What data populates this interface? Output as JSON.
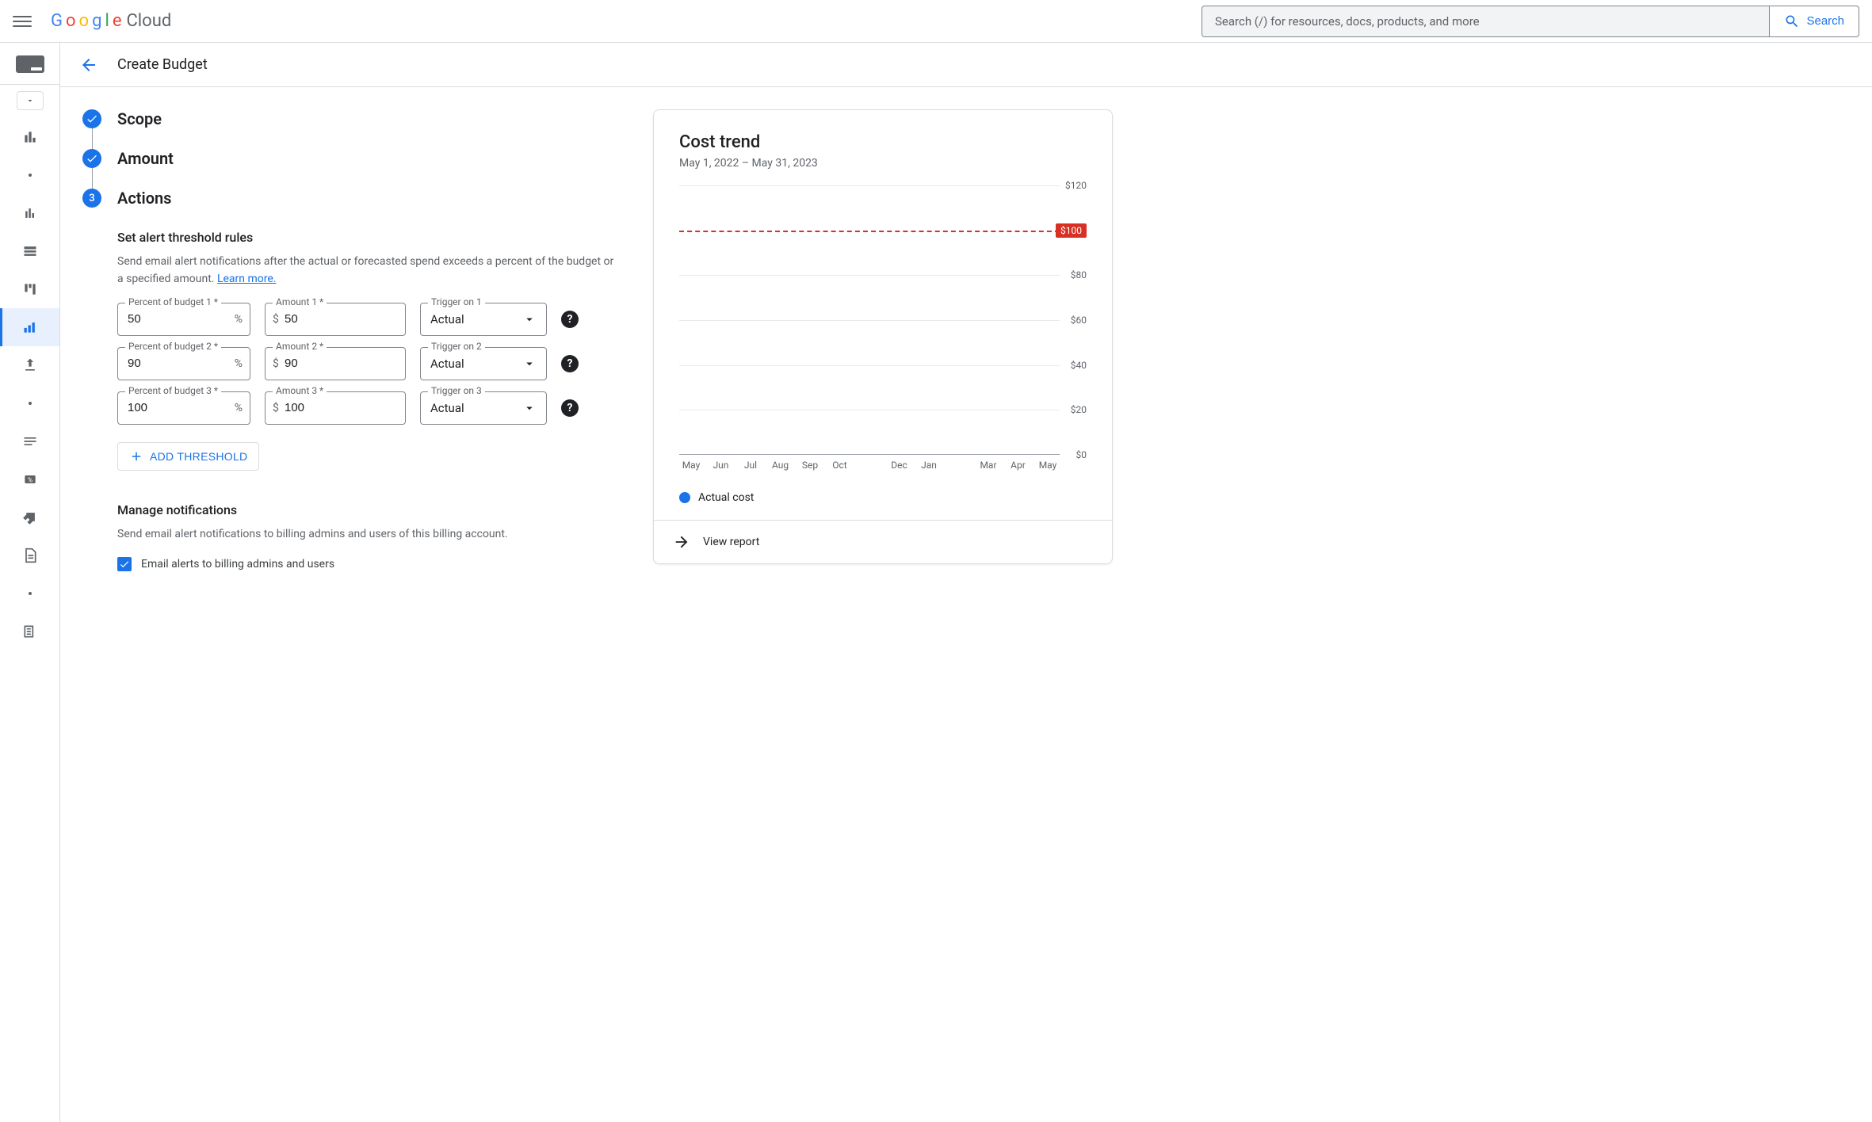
{
  "header": {
    "logo_cloud": "Cloud",
    "search_placeholder": "Search (/) for resources, docs, products, and more",
    "search_button": "Search"
  },
  "page": {
    "title": "Create Budget"
  },
  "stepper": {
    "scope": "Scope",
    "amount": "Amount",
    "actions": "Actions",
    "current_step_number": "3"
  },
  "thresholds": {
    "heading": "Set alert threshold rules",
    "description": "Send email alert notifications after the actual or forecasted spend exceeds a percent of the budget or a specified amount. ",
    "learn_more": "Learn more.",
    "labels": {
      "percent_prefix": "Percent of budget ",
      "amount_prefix": "Amount ",
      "trigger_prefix": "Trigger on ",
      "required_suffix": " *"
    },
    "percent_suffix": "%",
    "amount_currency": "$",
    "rules": [
      {
        "percent": "50",
        "amount": "50",
        "trigger": "Actual"
      },
      {
        "percent": "90",
        "amount": "90",
        "trigger": "Actual"
      },
      {
        "percent": "100",
        "amount": "100",
        "trigger": "Actual"
      }
    ],
    "add_button": "ADD THRESHOLD"
  },
  "notifications": {
    "heading": "Manage notifications",
    "description": "Send email alert notifications to billing admins and users of this billing account.",
    "checkbox_label": "Email alerts to billing admins and users",
    "checkbox_checked": true
  },
  "cost_trend": {
    "title": "Cost trend",
    "subtitle": "May 1, 2022 – May 31, 2023",
    "legend_actual": "Actual cost",
    "view_report": "View report"
  },
  "chart_data": {
    "type": "line",
    "title": "Cost trend",
    "xlabel": "",
    "ylabel": "",
    "ylim": [
      0,
      120
    ],
    "y_ticks": [
      0,
      20,
      40,
      60,
      80,
      120
    ],
    "y_tick_labels": [
      "$0",
      "$20",
      "$40",
      "$60",
      "$80",
      "$120"
    ],
    "budget_line_value": 100,
    "budget_line_label": "$100",
    "categories": [
      "May",
      "Jun",
      "Jul",
      "Aug",
      "Sep",
      "Oct",
      "",
      "Dec",
      "Jan",
      "",
      "Mar",
      "Apr",
      "May"
    ],
    "series": [
      {
        "name": "Actual cost",
        "values": []
      }
    ]
  }
}
